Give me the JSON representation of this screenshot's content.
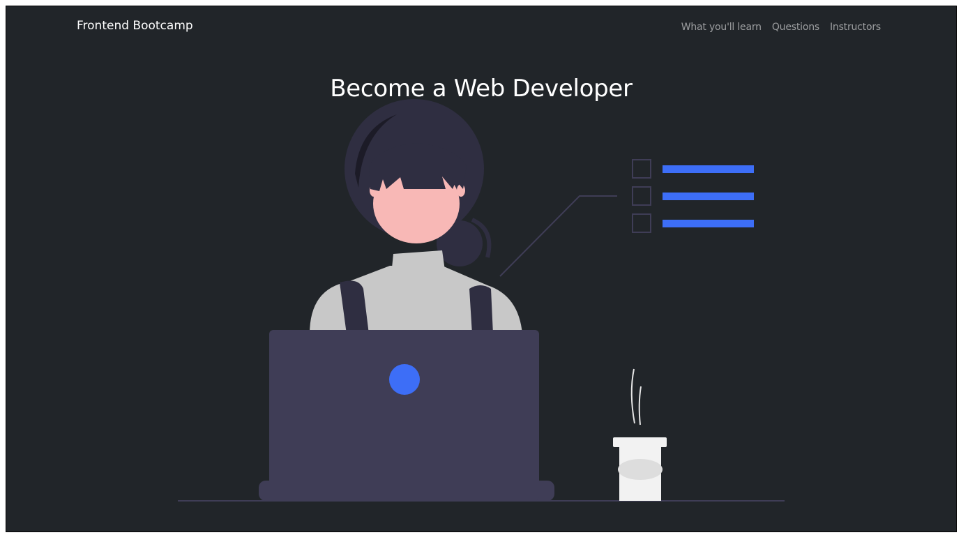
{
  "navbar": {
    "brand": "Frontend Bootcamp",
    "links": [
      {
        "label": "What you'll learn"
      },
      {
        "label": "Questions"
      },
      {
        "label": "Instructors"
      }
    ]
  },
  "hero": {
    "title": "Become a Web Developer"
  },
  "colors": {
    "background": "#212529",
    "accent": "#3d6ef7",
    "laptop": "#3f3d56",
    "skin": "#f8b8b6",
    "hair": "#2f2e41",
    "shirt": "#c8c8c8"
  },
  "illustration": {
    "icon": "woman-at-laptop-illustration"
  }
}
